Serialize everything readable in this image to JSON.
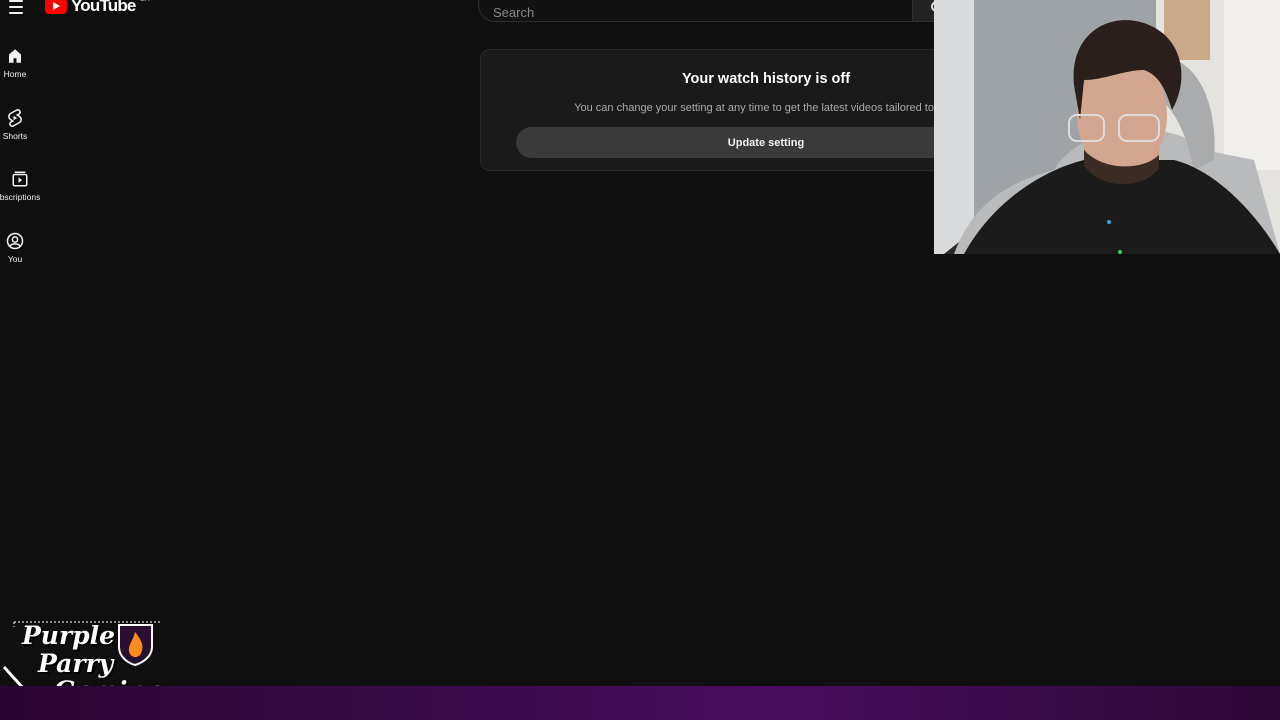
{
  "header": {
    "logo_text": "YouTube",
    "logo_suffix": "CA",
    "search_placeholder": "Search"
  },
  "sidebar": {
    "items": [
      {
        "label": "Home",
        "icon": "home-icon"
      },
      {
        "label": "Shorts",
        "icon": "shorts-icon"
      },
      {
        "label": "bscriptions",
        "icon": "subscriptions-icon"
      },
      {
        "label": "You",
        "icon": "account-icon"
      }
    ]
  },
  "history_card": {
    "title": "Your watch history is off",
    "description": "You can change your setting at any time to get the latest videos tailored to you.",
    "button_label": "Update setting"
  },
  "stream_brand": {
    "line1": "Purple",
    "line2": "Parry",
    "line3": "Gaming"
  },
  "colors": {
    "background": "#0f0f10",
    "youtube_red": "#ff0000",
    "card_bg": "#1a1a1b",
    "button_bg": "#3a3a3a",
    "band_purple": "#4a0c5e"
  }
}
